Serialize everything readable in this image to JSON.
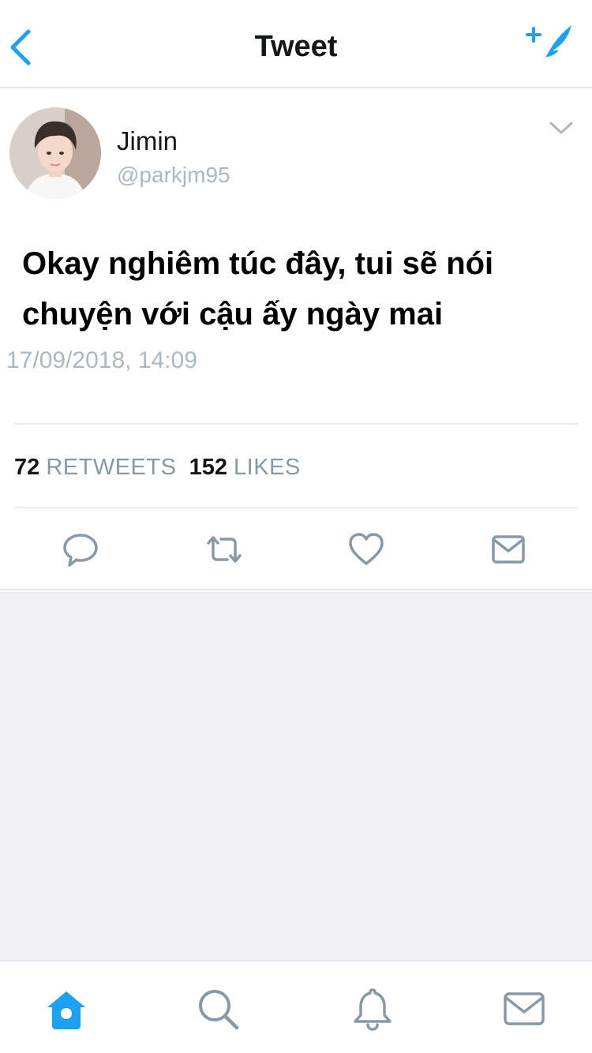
{
  "header": {
    "title": "Tweet",
    "back_icon": "chevron-left-icon",
    "compose_icon": "compose-feather-icon",
    "accent_color": "#1da1f2"
  },
  "tweet": {
    "user": {
      "name": "Jimin",
      "handle": "@parkjm95",
      "avatar_icon": "user-avatar-photo"
    },
    "text": "Okay nghiêm túc đây, tui sẽ nói chuyện với cậu ấy ngày mai",
    "timestamp": "17/09/2018, 14:09",
    "stats": {
      "retweets_count": "72",
      "retweets_label": "RETWEETS",
      "likes_count": "152",
      "likes_label": "LIKES"
    },
    "actions": [
      "reply-icon",
      "retweet-icon",
      "like-heart-icon",
      "direct-message-icon"
    ],
    "menu_icon": "chevron-down-icon"
  },
  "tabbar": {
    "items": [
      "home-icon",
      "search-icon",
      "notifications-bell-icon",
      "messages-icon"
    ],
    "active": "home-icon",
    "active_color": "#1da1f2",
    "inactive_color": "#8899a6"
  }
}
